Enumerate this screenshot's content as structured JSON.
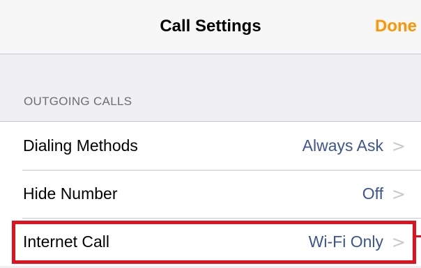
{
  "navbar": {
    "title": "Call Settings",
    "done_label": "Done"
  },
  "section": {
    "header": "OUTGOING CALLS"
  },
  "rows": [
    {
      "label": "Dialing Methods",
      "value": "Always Ask",
      "chevron": ">"
    },
    {
      "label": "Hide Number",
      "value": "Off",
      "chevron": ">"
    },
    {
      "label": "Internet Call",
      "value": "Wi-Fi Only",
      "chevron": ">"
    }
  ],
  "colors": {
    "accent": "#ff9500",
    "value_text": "#3c5591",
    "highlight": "#e0121f"
  }
}
